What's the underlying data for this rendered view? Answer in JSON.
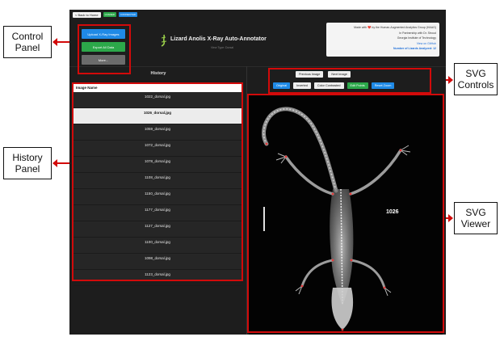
{
  "annotations": {
    "control_panel": [
      "Control",
      "Panel"
    ],
    "history_panel": [
      "History",
      "Panel"
    ],
    "svg_controls": [
      "SVG",
      "Controls"
    ],
    "svg_viewer": [
      "SVG",
      "Viewer"
    ]
  },
  "topbar": {
    "back_label": "< Back to Home",
    "badges": [
      {
        "label": "LOADED",
        "color": "#2ca84a"
      },
      {
        "label": "CONNECTED",
        "color": "#1f8ae6"
      }
    ]
  },
  "controls": {
    "upload_label": "Upload X-Ray Images",
    "export_label": "Export All Data",
    "more_label": "More..."
  },
  "header": {
    "title": "Lizard Anolis X-Ray Auto-Annotator",
    "subtitle": "View Type: Dorsal"
  },
  "info_card": {
    "made_with": "Made with ❤️ by the Human-Augmented Analytics Group (HAAG)",
    "partnership": "In Partnership with Dr. Stroud",
    "institution": "Georgia Institute of Technology",
    "github_link": "View on GitHub",
    "analyzed_label": "Number of Lizards Analyzed: 12"
  },
  "history": {
    "heading": "History",
    "column_header": "Image Name",
    "rows": [
      {
        "name": "1022_dorsal.jpg",
        "selected": false
      },
      {
        "name": "1026_dorsal.jpg",
        "selected": true
      },
      {
        "name": "1059_dorsal.jpg",
        "selected": false
      },
      {
        "name": "1072_dorsal.jpg",
        "selected": false
      },
      {
        "name": "1078_dorsal.jpg",
        "selected": false
      },
      {
        "name": "1108_dorsal.jpg",
        "selected": false
      },
      {
        "name": "1150_dorsal.jpg",
        "selected": false
      },
      {
        "name": "1177_dorsal.jpg",
        "selected": false
      },
      {
        "name": "1127_dorsal.jpg",
        "selected": false
      },
      {
        "name": "1100_dorsal.jpg",
        "selected": false
      },
      {
        "name": "1098_dorsal.jpg",
        "selected": false
      },
      {
        "name": "1123_dorsal.jpg",
        "selected": false
      }
    ]
  },
  "svg_controls": {
    "previous_label": "Previous Image",
    "next_label": "Next Image",
    "original_label": "Original",
    "inverted_label": "Inverted",
    "contrasted_label": "Color Contrasted",
    "edit_points_label": "Edit Points",
    "reset_zoom_label": "Reset Zoom"
  },
  "viewer": {
    "specimen_id": "1026"
  },
  "colors": {
    "highlight": "#d20a0a",
    "app_bg": "#1d1d1d",
    "primary_blue": "#1f8ae6",
    "green": "#2ca84a",
    "gray": "#6b6b6b"
  }
}
